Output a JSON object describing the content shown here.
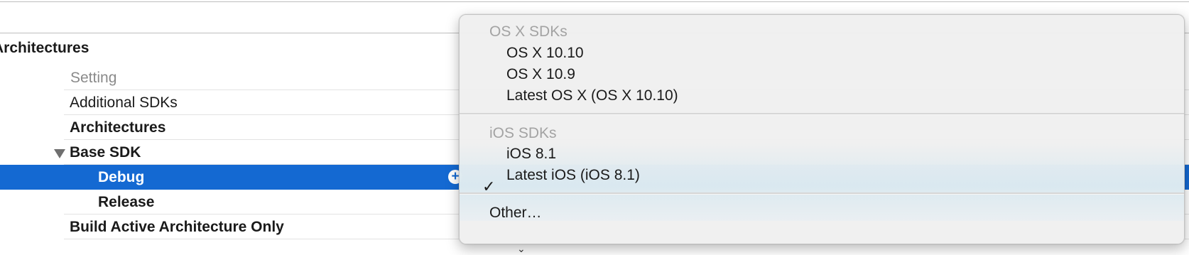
{
  "section": {
    "title": "Architectures"
  },
  "table": {
    "column_header": "Setting",
    "rows": [
      {
        "label": "Additional SDKs"
      },
      {
        "label": "Architectures"
      },
      {
        "label": "Base SDK"
      },
      {
        "label": "Debug"
      },
      {
        "label": "Release"
      },
      {
        "label": "Build Active Architecture Only"
      }
    ],
    "add_icon": "+",
    "popup_stub": "⌄"
  },
  "menu": {
    "osx_group_title": "OS X SDKs",
    "osx_items": [
      "OS X 10.10",
      "OS X 10.9",
      "Latest OS X (OS X 10.10)"
    ],
    "ios_group_title": "iOS SDKs",
    "ios_items": [
      "iOS 8.1",
      "Latest iOS (iOS 8.1)"
    ],
    "selected_item": "Latest iOS (iOS 8.1)",
    "checkmark": "✓",
    "other_label": "Other…"
  },
  "colors": {
    "selection": "#1469d2",
    "menu_background": "#f0f0f0",
    "group_title": "#a3a3a3"
  }
}
